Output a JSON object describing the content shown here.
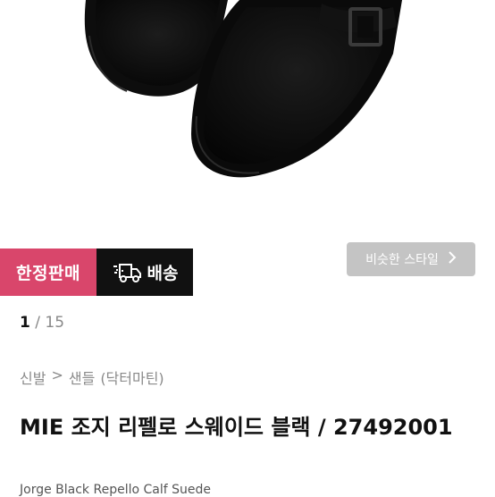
{
  "product_image": {
    "alt_name": "black-suede-clog-shoes"
  },
  "badges": {
    "limited": "한정판매",
    "delivery": "배송",
    "delivery_icon": "truck-fast-icon"
  },
  "similar_style": {
    "label": "비슷한 스타일",
    "icon": "chevron-right-icon"
  },
  "image_counter": {
    "current": "1",
    "separator": "/",
    "total": "15"
  },
  "breadcrumb": {
    "category": "신발",
    "separator": ">",
    "subcategory": "샌들",
    "brand": "(닥터마틴)"
  },
  "product": {
    "title": "MIE 조지 리펠로 스웨이드 블랙 / 27492001",
    "subtitle": "Jorge Black Repello Calf Suede"
  },
  "colors": {
    "limited_bg": "#d9466b",
    "delivery_bg": "#111111",
    "similar_bg": "#c4c4c4"
  }
}
